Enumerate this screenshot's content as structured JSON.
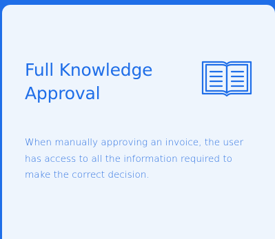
{
  "card": {
    "title": "Full Knowledge Approval",
    "icon": "open-book-icon",
    "description": "When manually approving an invoice, the user has access to all the information required to make the correct decision.",
    "colors": {
      "background": "#1f6ee8",
      "card": "#eef5fd",
      "accent": "#1f6ee8"
    }
  }
}
